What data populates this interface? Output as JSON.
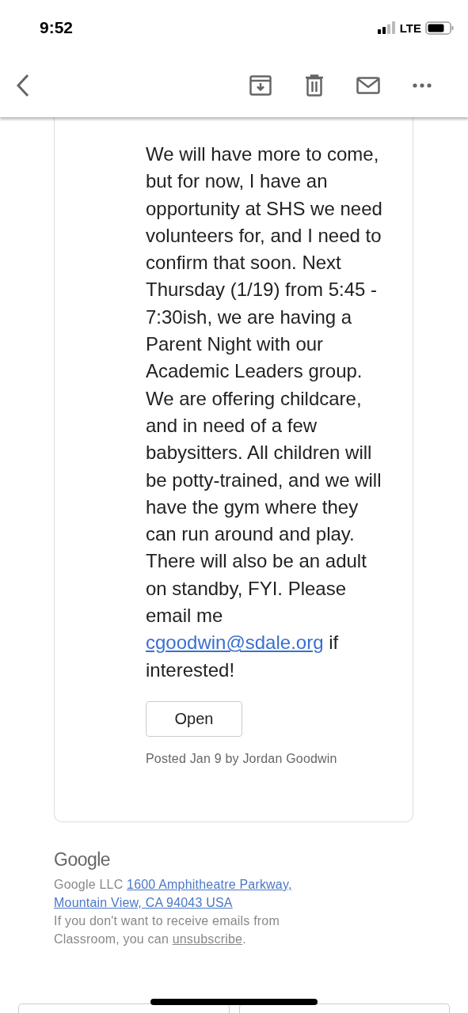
{
  "status_bar": {
    "time": "9:52",
    "network": "LTE"
  },
  "toolbar": {
    "actions": [
      {
        "kind": "archive"
      },
      {
        "kind": "delete"
      },
      {
        "kind": "mail"
      },
      {
        "kind": "more"
      }
    ]
  },
  "post": {
    "body_before_link": "We will have more to come, but for now, I have an opportunity at SHS we need volunteers for, and I need to confirm that soon. Next Thursday (1/19) from 5:45 - 7:30ish, we are having a Parent Night with our Academic Leaders group. We are offering childcare, and in need of a few babysitters. All children will be potty-trained, and we will have the gym where they can run around and play. There will also be an adult on standby, FYI. Please email me",
    "email_link": "cgoodwin@sdale.org",
    "body_after_link": "if interested!",
    "open_button": "Open",
    "posted": "Posted Jan 9 by Jordan Goodwin"
  },
  "footer": {
    "logo": "Google",
    "company": "Google LLC",
    "address_lines": [
      "1600 Amphitheatre Parkway,",
      "Mountain View, CA 94043 USA"
    ],
    "unsubscribe_before": "If you don't want to receive emails from Classroom, you can",
    "unsubscribe_link": "unsubscribe",
    "unsubscribe_after": "."
  }
}
